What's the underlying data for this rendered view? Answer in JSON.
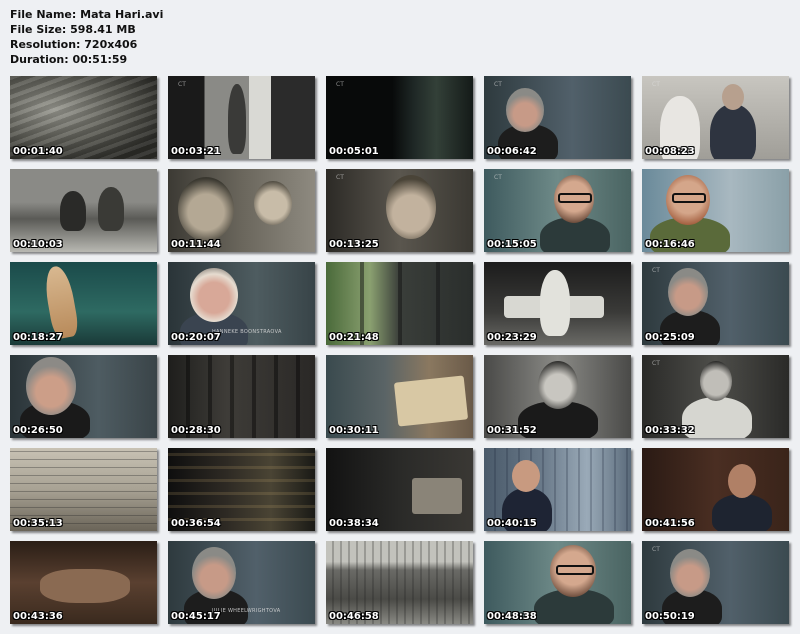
{
  "file_info": {
    "name_line": "File Name: Mata Hari.avi",
    "size_line": "File Size: 598.41 MB",
    "resolution_line": "Resolution: 720x406",
    "duration_line": "Duration: 00:51:59"
  },
  "thumbnails": [
    {
      "time": "00:01:40",
      "scene": "grayscale battlefield rubble"
    },
    {
      "time": "00:03:21",
      "scene": "grayscale dancer with veil"
    },
    {
      "time": "00:05:01",
      "scene": "dark blurred interior"
    },
    {
      "time": "00:06:42",
      "scene": "interview woman grey hair"
    },
    {
      "time": "00:08:23",
      "scene": "sepia wedding portrait couple"
    },
    {
      "time": "00:10:03",
      "scene": "grayscale women by water"
    },
    {
      "time": "00:11:44",
      "scene": "sepia man with moustache and child"
    },
    {
      "time": "00:13:25",
      "scene": "sepia portrait woman"
    },
    {
      "time": "00:15:05",
      "scene": "interview bald man glasses"
    },
    {
      "time": "00:16:46",
      "scene": "interview bearded man glasses"
    },
    {
      "time": "00:18:27",
      "scene": "color dancer costume"
    },
    {
      "time": "00:20:07",
      "scene": "interview blonde woman",
      "caption": "HANNEKE BOONSTRAOVA"
    },
    {
      "time": "00:21:48",
      "scene": "window with greenery"
    },
    {
      "time": "00:23:29",
      "scene": "grayscale woman on bench"
    },
    {
      "time": "00:25:09",
      "scene": "interview woman grey hair"
    },
    {
      "time": "00:26:50",
      "scene": "interview woman close"
    },
    {
      "time": "00:28:30",
      "scene": "dark street scene"
    },
    {
      "time": "00:30:11",
      "scene": "hands with documents"
    },
    {
      "time": "00:31:52",
      "scene": "grayscale man portrait moustache"
    },
    {
      "time": "00:33:32",
      "scene": "grayscale officer in uniform"
    },
    {
      "time": "00:35:13",
      "scene": "document text close-up"
    },
    {
      "time": "00:36:54",
      "scene": "building facade at night"
    },
    {
      "time": "00:38:34",
      "scene": "dark desk hands writing"
    },
    {
      "time": "00:40:15",
      "scene": "man in suit in library"
    },
    {
      "time": "00:41:56",
      "scene": "man gesturing in dark room"
    },
    {
      "time": "00:43:36",
      "scene": "woman lying down close-up"
    },
    {
      "time": "00:45:17",
      "scene": "interview woman grey hair",
      "caption": "JULIE WHEELWRIGHTOVA"
    },
    {
      "time": "00:46:58",
      "scene": "grayscale aerial city view"
    },
    {
      "time": "00:48:38",
      "scene": "interview bald man glasses"
    },
    {
      "time": "00:50:19",
      "scene": "interview woman grey hair"
    }
  ],
  "colors": {
    "background": "#eef0f3",
    "timestamp_text": "#ffffff"
  }
}
